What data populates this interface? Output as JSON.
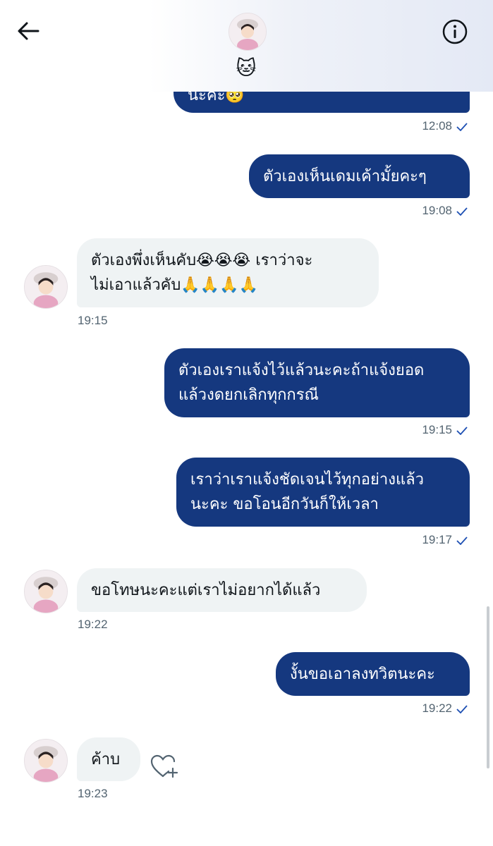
{
  "header": {
    "status_emoji": "🐱"
  },
  "messages": [
    {
      "dir": "out",
      "text": "นะคะ🥺",
      "time": "12:08"
    },
    {
      "dir": "out",
      "text": "ตัวเองเห็นเดมเค้ามั้ยคะๆ",
      "time": "19:08"
    },
    {
      "dir": "in",
      "lines": [
        "ตัวเองพึ่งเห็นคับ😭😭😭 เราว่าจะ",
        "ไม่เอาแล้วคับ🙏🙏🙏🙏"
      ],
      "time": "19:15"
    },
    {
      "dir": "out",
      "lines": [
        "ตัวเองเราแจ้งไว้แล้วนะคะถ้าแจ้งยอด",
        "แล้วงดยกเลิกทุกกรณี"
      ],
      "time": "19:15"
    },
    {
      "dir": "out",
      "lines": [
        "เราว่าเราแจ้งชัดเจนไว้ทุกอย่างแล้ว",
        "นะคะ ขอโอนอีกวันก็ให้เวลา"
      ],
      "time": "19:17"
    },
    {
      "dir": "in",
      "text": "ขอโทษนะคะแต่เราไม่อยากได้แล้ว",
      "time": "19:22"
    },
    {
      "dir": "out",
      "text": "งั้นขอเอาลงทวิตนะคะ",
      "time": "19:22"
    },
    {
      "dir": "in",
      "text": "ค้าบ",
      "time": "19:23"
    }
  ],
  "colors": {
    "outgoing_bubble": "#15387f",
    "incoming_bubble": "#eff3f4",
    "timestamp": "#536471"
  },
  "icons": [
    "back-arrow-icon",
    "info-icon",
    "read-check-icon",
    "heart-plus-icon"
  ]
}
